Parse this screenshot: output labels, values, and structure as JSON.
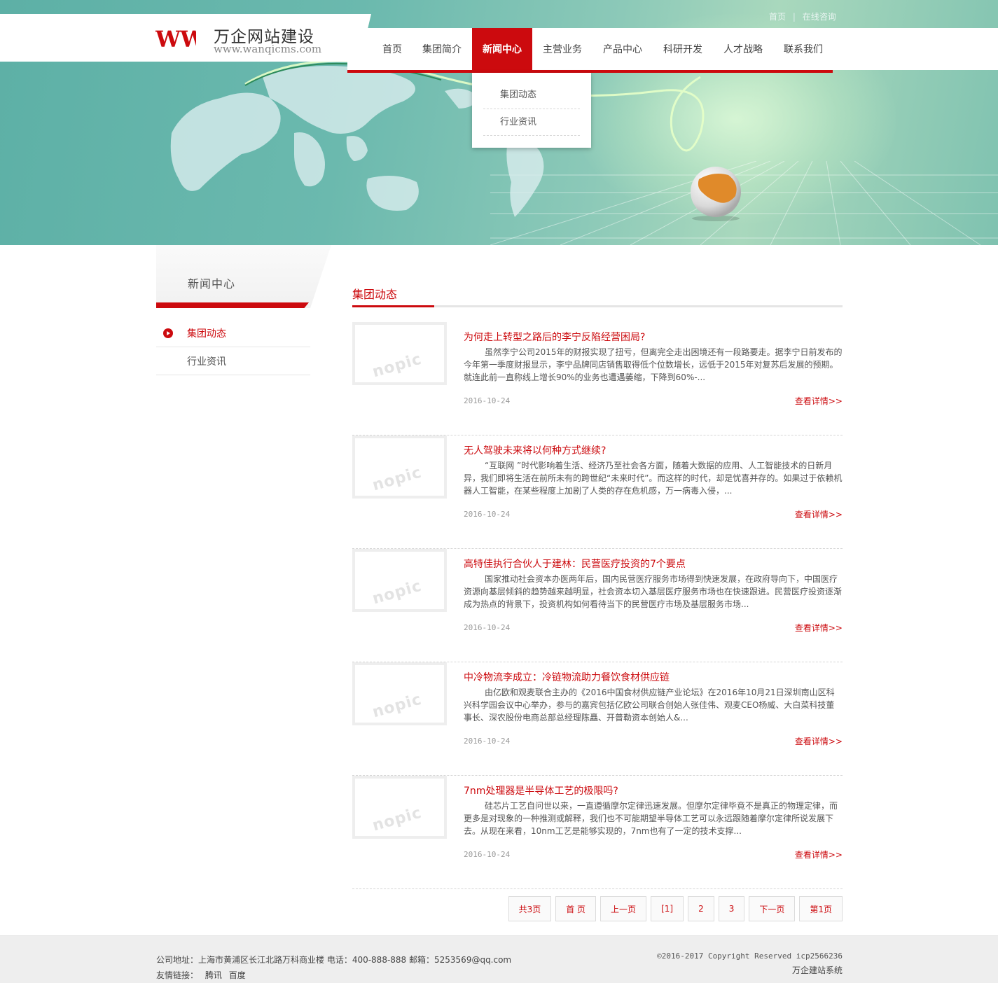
{
  "top_links": {
    "home": "首页",
    "separator": "|",
    "consult": "在线咨询"
  },
  "logo": {
    "mark": "W W",
    "title": "万企网站建设",
    "url": "www.wanqicms.com"
  },
  "nav": {
    "items": [
      {
        "label": "首页"
      },
      {
        "label": "集团简介"
      },
      {
        "label": "新闻中心"
      },
      {
        "label": "主营业务"
      },
      {
        "label": "产品中心"
      },
      {
        "label": "科研开发"
      },
      {
        "label": "人才战略"
      },
      {
        "label": "联系我们"
      }
    ],
    "active_index": 2,
    "dropdown": [
      {
        "label": "集团动态"
      },
      {
        "label": "行业资讯"
      }
    ]
  },
  "sidebar": {
    "title": "新闻中心",
    "items": [
      {
        "label": "集团动态"
      },
      {
        "label": "行业资讯"
      }
    ],
    "active_index": 0
  },
  "main": {
    "section_title": "集团动态",
    "thumb_placeholder": "nopic",
    "more_label": "查看详情>>",
    "news": [
      {
        "title": "为何走上转型之路后的李宁反陷经营困局?",
        "summary": "虽然李宁公司2015年的财报实现了扭亏，但离完全走出困境还有一段路要走。据李宁日前发布的今年第一季度财报显示，李宁品牌同店销售取得低个位数增长，远低于2015年对复苏后发展的预期。就连此前一直称线上增长90%的业务也遭遇萎缩，下降到60%-...",
        "date": "2016-10-24"
      },
      {
        "title": "无人驾驶未来将以何种方式继续?",
        "summary": "“互联网 ”时代影响着生活、经济乃至社会各方面，随着大数据的应用、人工智能技术的日新月异，我们即将生活在前所未有的跨世纪“未来时代”。而这样的时代，却是忧喜并存的。如果过于依赖机器人工智能，在某些程度上加剧了人类的存在危机感，万一病毒入侵，...",
        "date": "2016-10-24"
      },
      {
        "title": "高特佳执行合伙人于建林：民营医疗投资的7个要点",
        "summary": "国家推动社会资本办医两年后，国内民营医疗服务市场得到快速发展，在政府导向下，中国医疗资源向基层倾斜的趋势越来越明显，社会资本切入基层医疗服务市场也在快速跟进。民营医疗投资逐渐成为热点的背景下，投资机构如何看待当下的民营医疗市场及基层服务市场...",
        "date": "2016-10-24"
      },
      {
        "title": "中冷物流李成立：冷链物流助力餐饮食材供应链",
        "summary": "由亿欧和观麦联合主办的《2016中国食材供应链产业论坛》在2016年10月21日深圳南山区科兴科学园会议中心举办，参与的嘉宾包括亿欧公司联合创始人张佳伟、观麦CEO杨威、大白菜科技董事长、深农股份电商总部总经理陈矗、开普勒资本创始人&...",
        "date": "2016-10-24"
      },
      {
        "title": "7nm处理器是半导体工艺的极限吗?",
        "summary": "硅芯片工艺自问世以来，一直遵循摩尔定律迅速发展。但摩尔定律毕竟不是真正的物理定律，而更多是对现象的一种推测或解释，我们也不可能期望半导体工艺可以永远跟随着摩尔定律所说发展下去。从现在来看，10nm工艺是能够实现的，7nm也有了一定的技术支撑...",
        "date": "2016-10-24"
      }
    ]
  },
  "pagination": {
    "buttons": [
      {
        "label": "共3页"
      },
      {
        "label": "首 页"
      },
      {
        "label": "上一页"
      },
      {
        "label": "[1]"
      },
      {
        "label": "2"
      },
      {
        "label": "3"
      },
      {
        "label": "下一页"
      },
      {
        "label": "第1页"
      }
    ]
  },
  "footer": {
    "address": "公司地址：上海市黄浦区长江北路万科商业楼 电话：400-888-888 邮箱：5253569@qq.com",
    "links_label": "友情链接：",
    "links": [
      "腾讯",
      "百度"
    ],
    "copyright": "©2016-2017 Copyright Reserved icp2566236",
    "system": "万企建站系统"
  },
  "colors": {
    "accent": "#cc0a0e",
    "banner": "#6bb9ae",
    "footer_bg": "#eeeeee"
  }
}
